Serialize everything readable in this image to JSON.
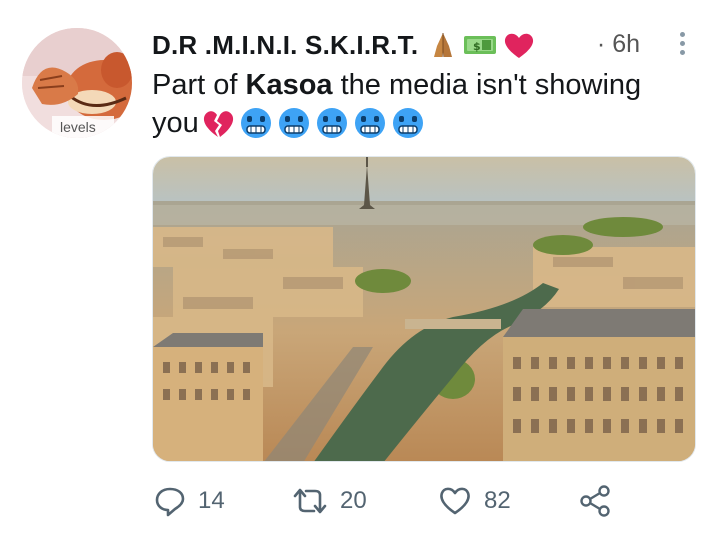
{
  "tweet": {
    "display_name": "D.R .M.I.N.I. S.K.I.R.T.",
    "name_emojis": [
      "folded-hands-emoji",
      "money-bill-emoji",
      "red-heart-emoji"
    ],
    "time_prefix": "·",
    "time": "6h",
    "text_before": "Part of ",
    "text_bold": "Kasoa",
    "text_after": " the media isn't showing",
    "text_line2": "you",
    "text_emojis": [
      "broken-heart-emoji",
      "cold-face-emoji",
      "cold-face-emoji",
      "cold-face-emoji",
      "cold-face-emoji",
      "cold-face-emoji"
    ],
    "avatar_caption": "levels",
    "media_alt": "Aerial view of Paris with the Seine and the Eiffel Tower"
  },
  "actions": {
    "reply_count": "14",
    "retweet_count": "20",
    "like_count": "82"
  },
  "colors": {
    "icon_gray": "#536471",
    "heart_red": "#e0245e",
    "cold_blue": "#3ea3f5"
  }
}
